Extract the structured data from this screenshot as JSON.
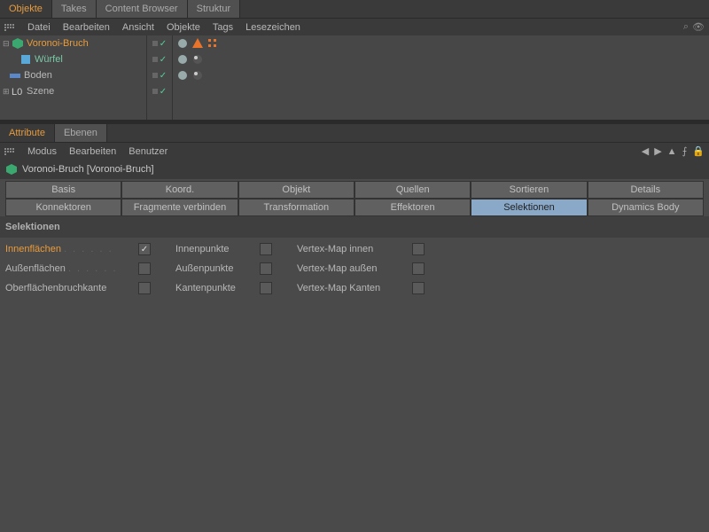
{
  "topTabs": {
    "objekte": "Objekte",
    "takes": "Takes",
    "contentBrowser": "Content Browser",
    "struktur": "Struktur"
  },
  "topMenu": [
    "Datei",
    "Bearbeiten",
    "Ansicht",
    "Objekte",
    "Tags",
    "Lesezeichen"
  ],
  "tree": {
    "items": [
      {
        "label": "Voronoi-Bruch",
        "style": "hl-orange"
      },
      {
        "label": "Würfel",
        "style": "hl-teal"
      },
      {
        "label": "Boden",
        "style": ""
      },
      {
        "label": "Szene",
        "style": ""
      }
    ]
  },
  "attrTabs": {
    "attribute": "Attribute",
    "ebenen": "Ebenen"
  },
  "attrMenu": [
    "Modus",
    "Bearbeiten",
    "Benutzer"
  ],
  "attrHeader": "Voronoi-Bruch [Voronoi-Bruch]",
  "gridTabs": {
    "row1": [
      "Basis",
      "Koord.",
      "Objekt",
      "Quellen",
      "Sortieren",
      "Details"
    ],
    "row2": [
      "Konnektoren",
      "Fragmente verbinden",
      "Transformation",
      "Effektoren",
      "Selektionen",
      "Dynamics Body"
    ],
    "activeIndex": 4
  },
  "sectionTitle": "Selektionen",
  "params": {
    "col1": [
      {
        "label": "Innenflächen",
        "dots": true,
        "checked": true,
        "hl": true
      },
      {
        "label": "Außenflächen",
        "dots": true,
        "checked": false
      },
      {
        "label": "Oberflächenbruchkante",
        "dots": false,
        "checked": false
      }
    ],
    "col2": [
      {
        "label": "Innenpunkte",
        "checked": false
      },
      {
        "label": "Außenpunkte",
        "checked": false
      },
      {
        "label": "Kantenpunkte",
        "checked": false
      }
    ],
    "col3": [
      {
        "label": "Vertex-Map innen",
        "checked": false
      },
      {
        "label": "Vertex-Map außen",
        "checked": false
      },
      {
        "label": "Vertex-Map Kanten",
        "checked": false
      }
    ]
  }
}
